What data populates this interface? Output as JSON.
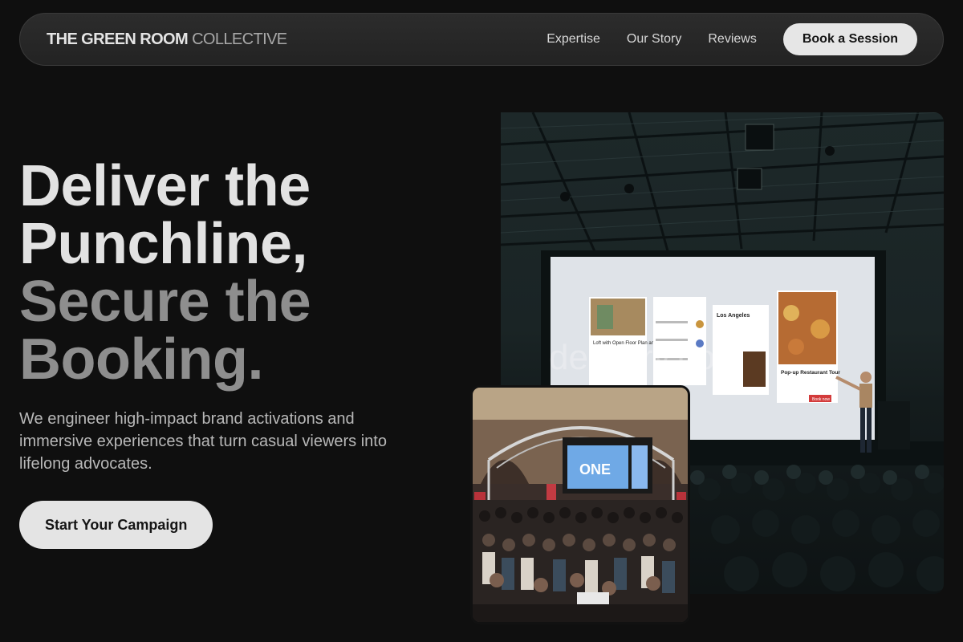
{
  "nav": {
    "brand_strong": "THE GREEN ROOM",
    "brand_light": "COLLECTIVE",
    "links": [
      "Expertise",
      "Our Story",
      "Reviews"
    ],
    "cta_label": "Book a Session"
  },
  "hero": {
    "headline_lines": [
      "Deliver the",
      "Punchline,",
      "Secure the",
      "Booking."
    ],
    "lede": "We engineer high-impact brand activations and immersive experiences that turn casual viewers into lifelong advocates.",
    "cta_label": "Start Your Campaign"
  },
  "images": {
    "main_screen": {
      "card1_title": "Loft with Open Floor Plan and Kitchen",
      "card3_title": "Los Angeles",
      "card4_title": "Pop-up Restaurant Tour",
      "card4_button": "Book now",
      "watermark": "delivery.com"
    },
    "inset_screen": {
      "headline": "ONE"
    }
  },
  "colors": {
    "background": "#0f0f0f",
    "nav_bg": "#262626",
    "cta_bg": "#e6e6e6",
    "headline_light": "#e2e2e2",
    "headline_dim": "#8e8e8e"
  }
}
